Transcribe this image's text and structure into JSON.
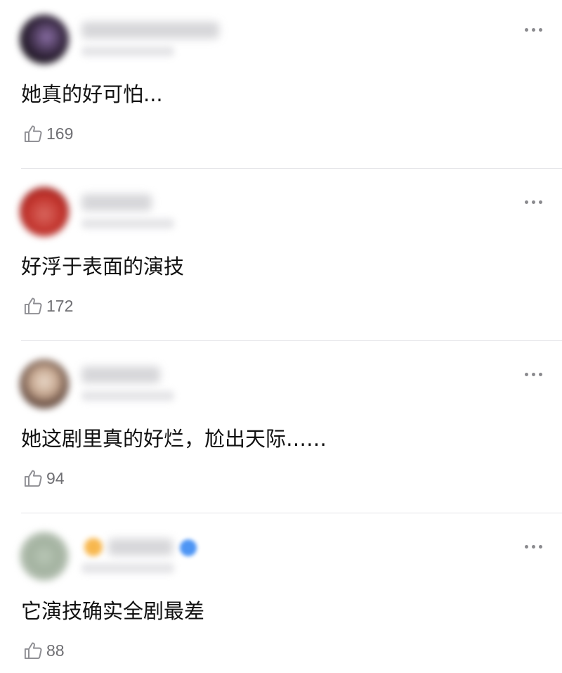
{
  "comments": [
    {
      "text": "她真的好可怕...",
      "likes": "169"
    },
    {
      "text": "好浮于表面的演技",
      "likes": "172"
    },
    {
      "text": "她这剧里真的好烂，尬出天际……",
      "likes": "94"
    },
    {
      "text": "它演技确实全剧最差",
      "likes": "88"
    }
  ],
  "colors": {
    "like_count": "#6f6f73",
    "more_dots": "#8a8a8e",
    "divider": "#e5e5e8"
  },
  "icons": {
    "like": "thumbs-up-outline-icon",
    "more": "more-horizontal-icon"
  }
}
